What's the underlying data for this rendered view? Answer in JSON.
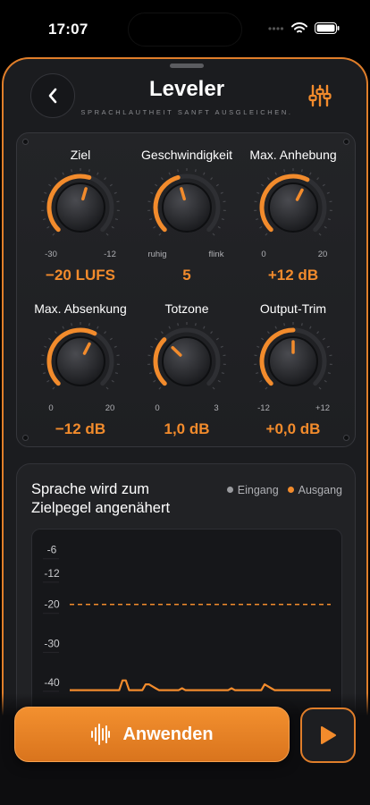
{
  "status": {
    "time": "17:07"
  },
  "header": {
    "title": "Leveler",
    "subtitle": "SPRACHLAUTHEIT SANFT AUSGLEICHEN."
  },
  "colors": {
    "accent": "#f28b2c",
    "sheet": "#1b1c1f",
    "input_series": "#9a9b9f"
  },
  "knobs": [
    {
      "label": "Ziel",
      "min": "-30",
      "max": "-12",
      "value": "−20 LUFS",
      "level": 0.56
    },
    {
      "label": "Geschwindigkeit",
      "min": "ruhig",
      "max": "flink",
      "value": "5",
      "level": 0.44
    },
    {
      "label": "Max. Anhebung",
      "min": "0",
      "max": "20",
      "value": "+12 dB",
      "level": 0.6
    },
    {
      "label": "Max. Absenkung",
      "min": "0",
      "max": "20",
      "value": "−12 dB",
      "level": 0.6
    },
    {
      "label": "Totzone",
      "min": "0",
      "max": "3",
      "value": "1,0 dB",
      "level": 0.33
    },
    {
      "label": "Output-Trim",
      "min": "-12",
      "max": "+12",
      "value": "+0,0 dB",
      "level": 0.5
    }
  ],
  "chart": {
    "title": "Sprache wird zum Zielpegel angenähert",
    "legend_input": "Eingang",
    "legend_output": "Ausgang"
  },
  "chart_data": {
    "type": "line",
    "title": "Sprache wird zum Zielpegel angenähert",
    "y_ticks": [
      "-6",
      "-12",
      "-20",
      "-30",
      "-40"
    ],
    "ylim": [
      -43,
      -4
    ],
    "target_line": -20,
    "series": [
      {
        "name": "Ausgang",
        "values": [
          -42,
          -42,
          -42,
          -42,
          -42,
          -42,
          -42,
          -42,
          -42,
          -42,
          -42,
          -42,
          -42,
          -42,
          -42,
          -42,
          -39.5,
          -39.5,
          -42,
          -42,
          -42,
          -42,
          -42,
          -40.5,
          -40.5,
          -41,
          -41.5,
          -42,
          -42,
          -42,
          -42,
          -42,
          -42,
          -42,
          -41.5,
          -42,
          -42,
          -42,
          -42,
          -42,
          -42,
          -42,
          -42,
          -42,
          -42,
          -42,
          -42,
          -42,
          -42,
          -41.5,
          -42,
          -42,
          -42,
          -42,
          -42,
          -42,
          -42,
          -42,
          -42,
          -40.5,
          -41,
          -41.5,
          -42,
          -42,
          -42,
          -42,
          -42,
          -42,
          -42,
          -42,
          -42,
          -42,
          -42,
          -42,
          -42,
          -42,
          -42,
          -42,
          -42,
          -42
        ]
      }
    ]
  },
  "actions": {
    "apply": "Anwenden"
  }
}
